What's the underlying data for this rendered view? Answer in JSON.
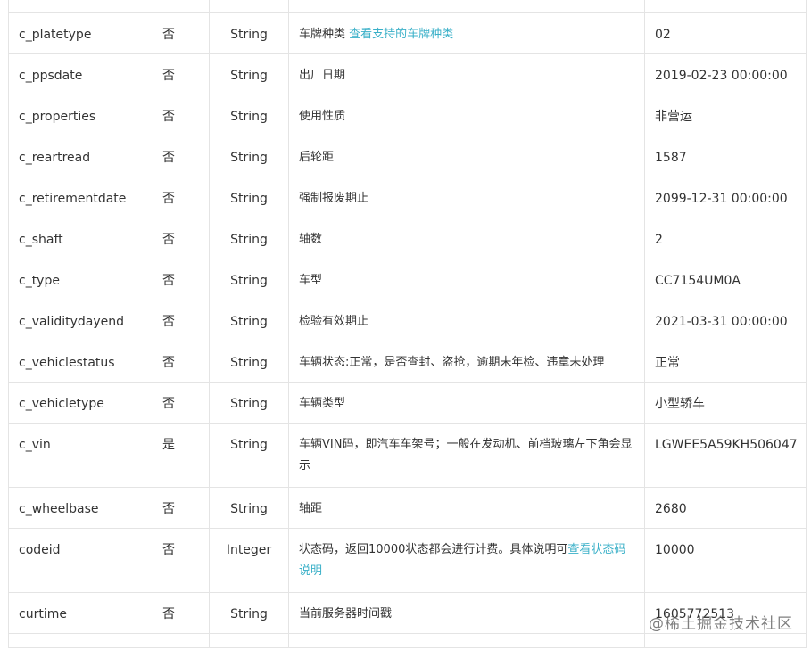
{
  "table": {
    "rows": [
      {
        "name": "c_platetype",
        "required": "否",
        "type": "String",
        "desc": "车牌种类 ",
        "desc_link": "查看支持的车牌种类",
        "desc_after": "",
        "example": "02"
      },
      {
        "name": "c_ppsdate",
        "required": "否",
        "type": "String",
        "desc": "出厂日期",
        "desc_link": "",
        "desc_after": "",
        "example": "2019-02-23 00:00:00"
      },
      {
        "name": "c_properties",
        "required": "否",
        "type": "String",
        "desc": "使用性质",
        "desc_link": "",
        "desc_after": "",
        "example": "非营运"
      },
      {
        "name": "c_reartread",
        "required": "否",
        "type": "String",
        "desc": "后轮距",
        "desc_link": "",
        "desc_after": "",
        "example": "1587"
      },
      {
        "name": "c_retirementdate",
        "required": "否",
        "type": "String",
        "desc": "强制报废期止",
        "desc_link": "",
        "desc_after": "",
        "example": "2099-12-31 00:00:00"
      },
      {
        "name": "c_shaft",
        "required": "否",
        "type": "String",
        "desc": "轴数",
        "desc_link": "",
        "desc_after": "",
        "example": "2"
      },
      {
        "name": "c_type",
        "required": "否",
        "type": "String",
        "desc": "车型",
        "desc_link": "",
        "desc_after": "",
        "example": "CC7154UM0A"
      },
      {
        "name": "c_validitydayend",
        "required": "否",
        "type": "String",
        "desc": "检验有效期止",
        "desc_link": "",
        "desc_after": "",
        "example": "2021-03-31 00:00:00"
      },
      {
        "name": "c_vehiclestatus",
        "required": "否",
        "type": "String",
        "desc": "车辆状态:正常，是否查封、盗抢，逾期未年检、违章未处理",
        "desc_link": "",
        "desc_after": "",
        "example": "正常"
      },
      {
        "name": "c_vehicletype",
        "required": "否",
        "type": "String",
        "desc": "车辆类型",
        "desc_link": "",
        "desc_after": "",
        "example": "小型轿车"
      },
      {
        "name": "c_vin",
        "required": "是",
        "type": "String",
        "desc": "车辆VIN码，即汽车车架号；一般在发动机、前档玻璃左下角会显示",
        "desc_link": "",
        "desc_after": "",
        "example": "LGWEE5A59KH506047"
      },
      {
        "name": "c_wheelbase",
        "required": "否",
        "type": "String",
        "desc": "轴距",
        "desc_link": "",
        "desc_after": "",
        "example": "2680"
      },
      {
        "name": "codeid",
        "required": "否",
        "type": "Integer",
        "desc": "状态码，返回10000状态都会进行计费。具体说明可",
        "desc_link": "查看状态码说明",
        "desc_after": "",
        "example": "10000"
      },
      {
        "name": "curtime",
        "required": "否",
        "type": "String",
        "desc": "当前服务器时间戳",
        "desc_link": "",
        "desc_after": "",
        "example": "1605772513"
      }
    ]
  },
  "watermark": "@稀土掘金技术社区",
  "colors": {
    "link": "#3ab0c8",
    "border": "#e4e4e4",
    "text": "#333333"
  }
}
